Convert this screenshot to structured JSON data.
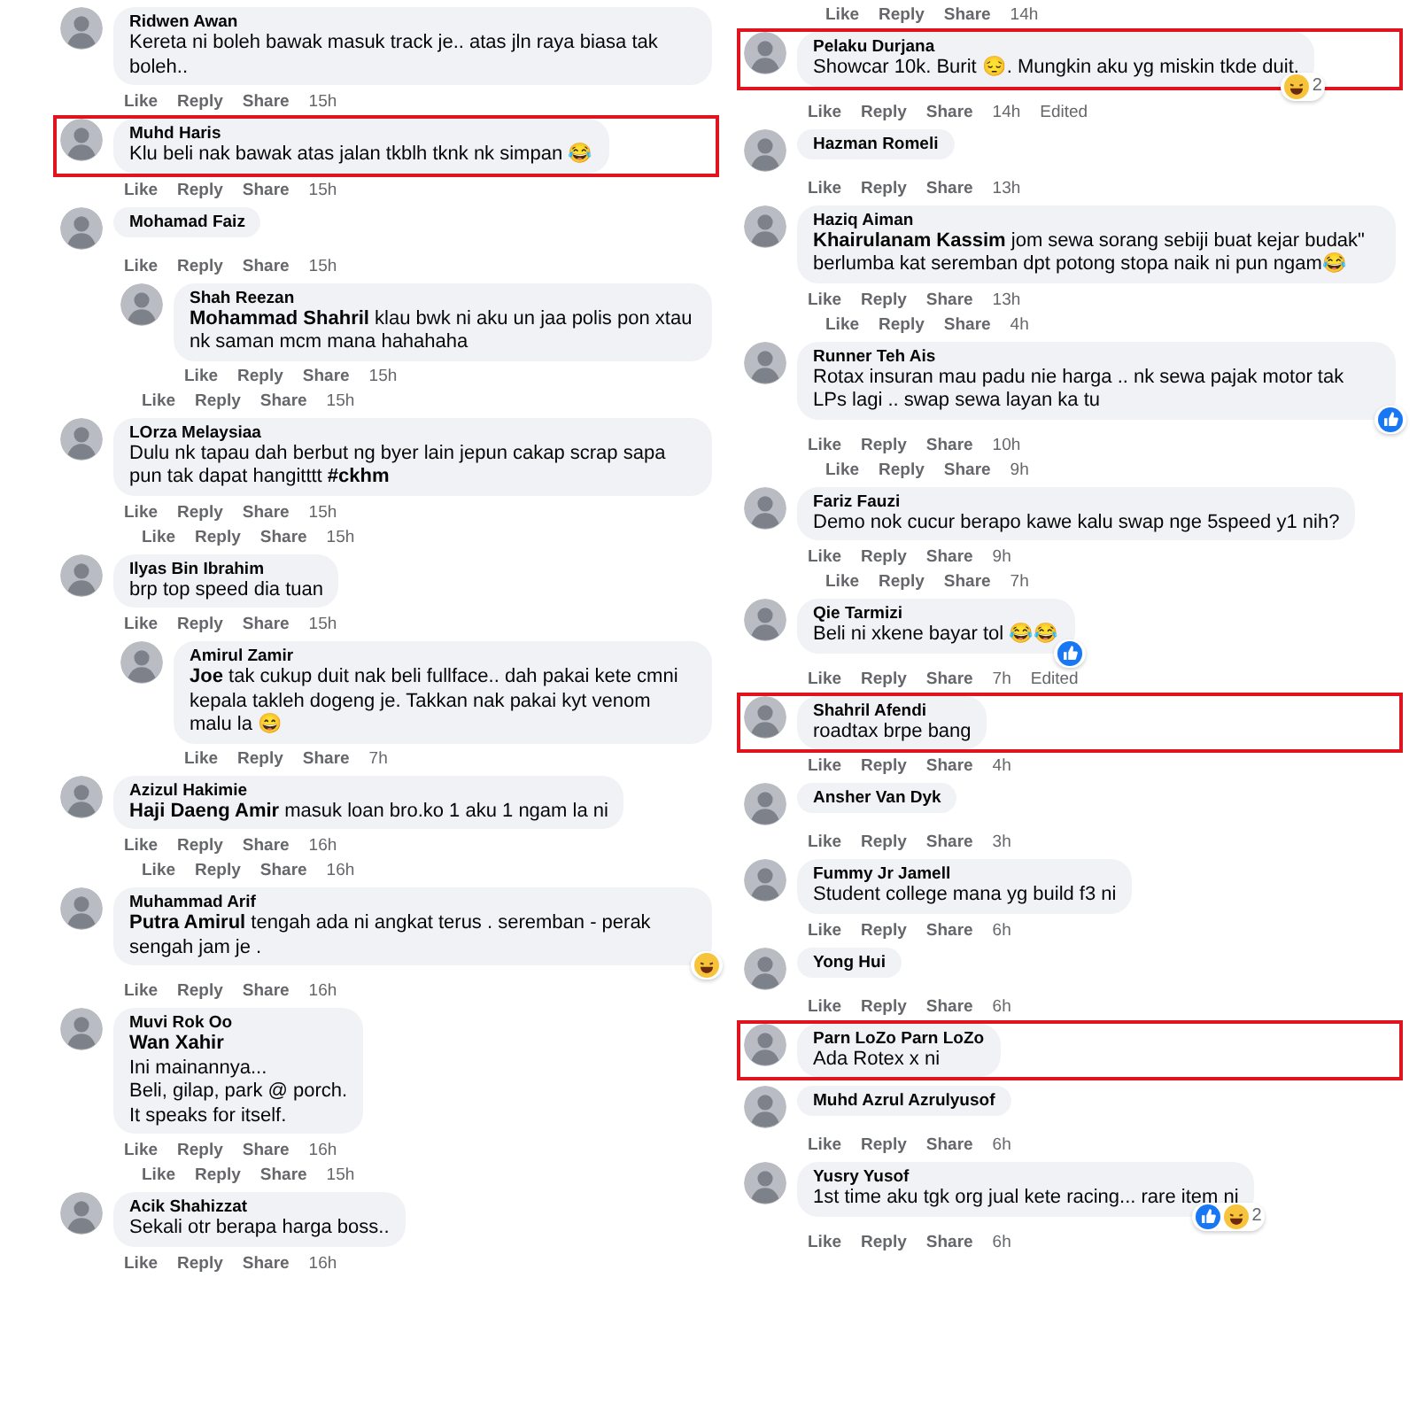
{
  "left": [
    {
      "kind": "comment",
      "highlighted": false,
      "name": "Ridwen Awan",
      "text": "Kereta ni boleh bawak masuk track je.. atas jln raya biasa tak boleh..",
      "actions": {
        "words": [
          "Like",
          "Reply",
          "Share"
        ],
        "time": "15h"
      }
    },
    {
      "kind": "comment",
      "highlighted": true,
      "name": "Muhd Haris",
      "text": "Klu beli nak bawak atas jalan tkblh tknk nk simpan 😂",
      "actions": {
        "words": [
          "Like",
          "Reply",
          "Share"
        ],
        "time": "15h"
      }
    },
    {
      "kind": "comment",
      "highlighted": false,
      "name": "Mohamad Faiz",
      "actions": {
        "words": [
          "Like",
          "Reply",
          "Share"
        ],
        "time": "15h"
      },
      "children": [
        {
          "kind": "comment",
          "highlighted": false,
          "name": "Shah Reezan",
          "text": "**Mohammad Shahril** klau bwk ni aku un jaa polis pon xtau nk saman mcm mana hahahaha",
          "actions": {
            "words": [
              "Like",
              "Reply",
              "Share"
            ],
            "time": "15h"
          }
        }
      ]
    },
    {
      "kind": "actions",
      "actions": {
        "words": [
          "Like",
          "Reply",
          "Share"
        ],
        "time": "15h"
      }
    },
    {
      "kind": "comment",
      "highlighted": false,
      "name": "LOrza Melaysiaa",
      "text": "Dulu nk tapau dah berbut ng byer lain jepun cakap scrap sapa pun tak dapat hangitttt **#ckhm**",
      "actions": {
        "words": [
          "Like",
          "Reply",
          "Share"
        ],
        "time": "15h"
      }
    },
    {
      "kind": "actions",
      "actions": {
        "words": [
          "Like",
          "Reply",
          "Share"
        ],
        "time": "15h"
      }
    },
    {
      "kind": "comment",
      "highlighted": false,
      "name": "Ilyas Bin Ibrahim",
      "text": "brp top speed dia tuan",
      "actions": {
        "words": [
          "Like",
          "Reply",
          "Share"
        ],
        "time": "15h"
      },
      "children": [
        {
          "kind": "comment",
          "highlighted": false,
          "name": "Amirul Zamir",
          "text": "**Joe** tak cukup duit nak beli fullface.. dah pakai kete cmni kepala takleh dogeng je. Takkan nak pakai kyt venom malu la 😄",
          "actions": {
            "words": [
              "Like",
              "Reply",
              "Share"
            ],
            "time": "7h"
          }
        }
      ]
    },
    {
      "kind": "comment",
      "highlighted": false,
      "name": "Azizul Hakimie",
      "text": "**Haji Daeng Amir** masuk loan bro.ko 1 aku 1 ngam la ni",
      "actions": {
        "words": [
          "Like",
          "Reply",
          "Share"
        ],
        "time": "16h"
      }
    },
    {
      "kind": "actions",
      "actions": {
        "words": [
          "Like",
          "Reply",
          "Share"
        ],
        "time": "16h"
      }
    },
    {
      "kind": "comment",
      "highlighted": false,
      "name": "Muhammad Arif",
      "text": "**Putra Amirul** tengah ada ni angkat terus . seremban - perak sengah jam je .",
      "reactions": [
        {
          "kind": "haha"
        }
      ],
      "actions": {
        "words": [
          "Like",
          "Reply",
          "Share"
        ],
        "time": "16h"
      }
    },
    {
      "kind": "comment",
      "highlighted": false,
      "name": "Muvi Rok Oo",
      "text": "**Wan Xahir**\nIni mainannya...\nBeli, gilap, park @ porch.\nIt speaks for itself.",
      "actions": {
        "words": [
          "Like",
          "Reply",
          "Share"
        ],
        "time": "16h"
      }
    },
    {
      "kind": "actions",
      "actions": {
        "words": [
          "Like",
          "Reply",
          "Share"
        ],
        "time": "15h"
      }
    },
    {
      "kind": "comment",
      "highlighted": false,
      "name": "Acik Shahizzat",
      "text": "Sekali otr berapa harga boss..",
      "actions": {
        "words": [
          "Like",
          "Reply",
          "Share"
        ],
        "time": "16h"
      }
    }
  ],
  "right": [
    {
      "kind": "actions",
      "actions": {
        "words": [
          "Like",
          "Reply",
          "Share"
        ],
        "time": "14h"
      }
    },
    {
      "kind": "comment",
      "highlighted": true,
      "name": "Pelaku Durjana",
      "text": "Showcar 10k. Burit 😔. Mungkin aku yg miskin tkde duit.",
      "reactions": [
        {
          "kind": "haha"
        }
      ],
      "reaction_count": "2",
      "actions": {
        "words": [
          "Like",
          "Reply",
          "Share"
        ],
        "time": "14h",
        "edited": "Edited"
      }
    },
    {
      "kind": "comment",
      "highlighted": false,
      "name": "Hazman Romeli",
      "actions": {
        "words": [
          "Like",
          "Reply",
          "Share"
        ],
        "time": "13h"
      }
    },
    {
      "kind": "comment",
      "highlighted": false,
      "name": "Haziq Aiman",
      "text": "**Khairulanam Kassim** jom sewa sorang sebiji buat kejar budak\" berlumba kat seremban dpt potong stopa naik ni pun ngam😂",
      "actions": {
        "words": [
          "Like",
          "Reply",
          "Share"
        ],
        "time": "13h"
      }
    },
    {
      "kind": "actions",
      "actions": {
        "words": [
          "Like",
          "Reply",
          "Share"
        ],
        "time": "4h"
      }
    },
    {
      "kind": "comment",
      "highlighted": false,
      "name": "Runner Teh Ais",
      "text": "Rotax insuran mau padu nie harga .. nk sewa pajak motor tak LPs lagi .. swap sewa layan ka tu",
      "reactions": [
        {
          "kind": "like"
        }
      ],
      "actions": {
        "words": [
          "Like",
          "Reply",
          "Share"
        ],
        "time": "10h"
      }
    },
    {
      "kind": "actions",
      "actions": {
        "words": [
          "Like",
          "Reply",
          "Share"
        ],
        "time": "9h"
      }
    },
    {
      "kind": "comment",
      "highlighted": false,
      "name": "Fariz Fauzi",
      "text": "Demo nok cucur berapo kawe kalu swap nge 5speed y1 nih?",
      "actions": {
        "words": [
          "Like",
          "Reply",
          "Share"
        ],
        "time": "9h"
      }
    },
    {
      "kind": "actions",
      "actions": {
        "words": [
          "Like",
          "Reply",
          "Share"
        ],
        "time": "7h"
      }
    },
    {
      "kind": "comment",
      "highlighted": false,
      "name": "Qie Tarmizi",
      "text": "Beli ni xkene bayar tol 😂😂",
      "reactions": [
        {
          "kind": "like"
        }
      ],
      "actions": {
        "words": [
          "Like",
          "Reply",
          "Share"
        ],
        "time": "7h",
        "edited": "Edited"
      }
    },
    {
      "kind": "comment",
      "highlighted": true,
      "name": "Shahril Afendi",
      "text": "roadtax brpe bang",
      "actions": {
        "words": [
          "Like",
          "Reply",
          "Share"
        ],
        "time": "4h"
      }
    },
    {
      "kind": "comment",
      "highlighted": false,
      "name": "Ansher Van Dyk",
      "actions": {
        "words": [
          "Like",
          "Reply",
          "Share"
        ],
        "time": "3h"
      }
    },
    {
      "kind": "comment",
      "highlighted": false,
      "name": "Fummy Jr Jamell",
      "text": "Student college mana yg build f3 ni",
      "actions": {
        "words": [
          "Like",
          "Reply",
          "Share"
        ],
        "time": "6h"
      }
    },
    {
      "kind": "comment",
      "highlighted": false,
      "name": "Yong Hui",
      "actions": {
        "words": [
          "Like",
          "Reply",
          "Share"
        ],
        "time": "6h"
      }
    },
    {
      "kind": "comment",
      "highlighted": true,
      "name": "Parn LoZo Parn LoZo",
      "text": "Ada Rotex x ni"
    },
    {
      "kind": "comment",
      "highlighted": false,
      "name": "Muhd Azrul Azrulyusof",
      "actions": {
        "words": [
          "Like",
          "Reply",
          "Share"
        ],
        "time": "6h"
      }
    },
    {
      "kind": "comment",
      "highlighted": false,
      "name": "Yusry Yusof",
      "text": "1st time aku tgk org jual kete racing... rare item ni",
      "reactions": [
        {
          "kind": "like"
        },
        {
          "kind": "haha"
        }
      ],
      "reaction_count": "2",
      "actions": {
        "words": [
          "Like",
          "Reply",
          "Share"
        ],
        "time": "6h"
      }
    }
  ]
}
